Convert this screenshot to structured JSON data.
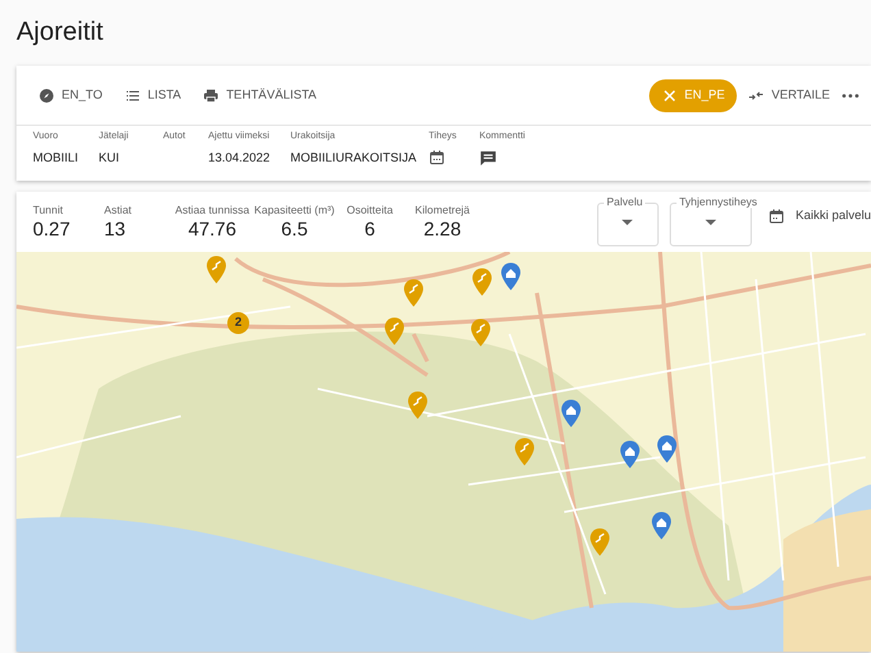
{
  "page_title": "Ajoreitit",
  "toolbar": {
    "buttons": [
      {
        "label": "EN_TO",
        "kind": "compass"
      },
      {
        "label": "LISTA",
        "kind": "list"
      },
      {
        "label": "TEHTÄVÄLISTA",
        "kind": "print"
      }
    ],
    "chip": {
      "label": "EN_PE"
    },
    "compare": {
      "label": "VERTAILE"
    }
  },
  "info_fields": [
    {
      "label": "Vuoro",
      "value": "MOBIILI",
      "kind": "text"
    },
    {
      "label": "Jätelaji",
      "value": "KUI",
      "kind": "text"
    },
    {
      "label": "Autot",
      "kind": "text"
    },
    {
      "label": "Ajettu viimeksi",
      "value": "13.04.2022",
      "kind": "text"
    },
    {
      "label": "Urakoitsija",
      "value": "MOBIILIURAKOITSIJA",
      "kind": "text"
    },
    {
      "label": "Tiheys",
      "kind": "calendar"
    },
    {
      "label": "Kommentti",
      "kind": "comment"
    }
  ],
  "stats": [
    {
      "label": "Tunnit",
      "value": "0.27"
    },
    {
      "label": "Astiat",
      "value": "13"
    },
    {
      "label": "Astiaa tunnissa",
      "value": "47.76"
    },
    {
      "label": "Kapasiteetti (m³)",
      "value": "6.5"
    },
    {
      "label": "Osoitteita",
      "value": "6"
    },
    {
      "label": "Kilometrejä",
      "value": "2.28"
    }
  ],
  "filters": [
    {
      "label": "Palvelu"
    },
    {
      "label": "Tyhjennystiheys"
    }
  ],
  "date_filter": {
    "value": "Kaikki palvelu"
  },
  "map": {
    "markers": [
      {
        "kind": "task"
      },
      {
        "kind": "cluster",
        "count": "2"
      },
      {
        "kind": "task"
      },
      {
        "kind": "task"
      },
      {
        "kind": "home"
      },
      {
        "kind": "task"
      },
      {
        "kind": "task"
      },
      {
        "kind": "task"
      },
      {
        "kind": "home"
      },
      {
        "kind": "task"
      },
      {
        "kind": "home"
      },
      {
        "kind": "home"
      },
      {
        "kind": "home"
      },
      {
        "kind": "task"
      }
    ]
  }
}
